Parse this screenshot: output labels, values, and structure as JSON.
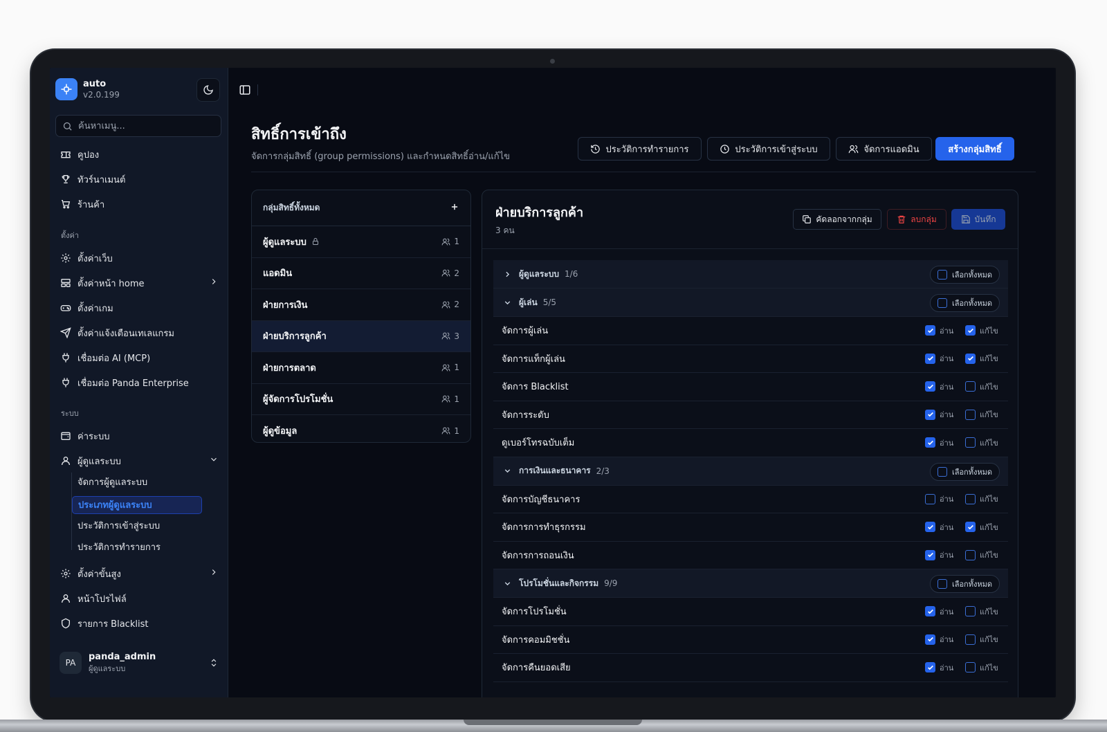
{
  "app": {
    "name": "auto",
    "version": "v2.0.199"
  },
  "search": {
    "placeholder": "ค้นหาเมนู..."
  },
  "nav": {
    "top": [
      {
        "label": "คูปอง",
        "icon": "ticket-icon"
      },
      {
        "label": "ทัวร์นาเมนต์",
        "icon": "trophy-icon"
      },
      {
        "label": "ร้านค้า",
        "icon": "cart-icon"
      }
    ],
    "settings_section": "ตั้งค่า",
    "settings": [
      {
        "label": "ตั้งค่าเว็บ",
        "icon": "gear-icon"
      },
      {
        "label": "ตั้งค่าหน้า home",
        "icon": "layout-icon"
      },
      {
        "label": "ตั้งค่าเกม",
        "icon": "gamepad-icon"
      },
      {
        "label": "ตั้งค่าแจ้งเตือนเทเลแกรม",
        "icon": "send-icon"
      },
      {
        "label": "เชื่อมต่อ AI (MCP)",
        "icon": "plug-icon"
      },
      {
        "label": "เชื่อมต่อ Panda Enterprise",
        "icon": "plug-icon"
      }
    ],
    "system_section": "ระบบ",
    "system": [
      {
        "label": "ค่าระบบ",
        "icon": "wallet-icon"
      },
      {
        "label": "ผู้ดูแลระบบ",
        "icon": "user-icon"
      }
    ],
    "admin_sub": [
      "จัดการผู้ดูแลระบบ",
      "ประเภทผู้ดูแลระบบ",
      "ประวัติการเข้าสู่ระบบ",
      "ประวัติการทำรายการ"
    ],
    "bottom": [
      {
        "label": "ตั้งค่าขั้นสูง",
        "icon": "gear-icon"
      },
      {
        "label": "หน้าโปรไฟล์",
        "icon": "user-icon"
      },
      {
        "label": "รายการ Blacklist",
        "icon": "shield-icon"
      }
    ]
  },
  "user": {
    "initials": "PA",
    "name": "panda_admin",
    "role": "ผู้ดูแลระบบ"
  },
  "page": {
    "title": "สิทธิ์การเข้าถึง",
    "subtitle": "จัดการกลุ่มสิทธิ์ (group permissions) และกำหนดสิทธิ์อ่าน/แก้ไข",
    "buttons": {
      "transaction_history": "ประวัติการทำรายการ",
      "login_history": "ประวัติการเข้าสู่ระบบ",
      "manage_admins": "จัดการแอดมิน",
      "create_group": "สร้างกลุ่มสิทธิ์"
    }
  },
  "groups": {
    "header": "กลุ่มสิทธิ์ทั้งหมด",
    "items": [
      {
        "name": "ผู้ดูแลระบบ",
        "count": "1",
        "locked": true
      },
      {
        "name": "แอดมิน",
        "count": "2"
      },
      {
        "name": "ฝ่ายการเงิน",
        "count": "2"
      },
      {
        "name": "ฝ่ายบริการลูกค้า",
        "count": "3",
        "active": true
      },
      {
        "name": "ฝ่ายการตลาด",
        "count": "1"
      },
      {
        "name": "ผู้จัดการโปรโมชั่น",
        "count": "1"
      },
      {
        "name": "ผู้ดูข้อมูล",
        "count": "1"
      }
    ]
  },
  "detail": {
    "title": "ฝ่ายบริการลูกค้า",
    "member_count": "3 คน",
    "copy_label": "คัดลอกจากกลุ่ม",
    "delete_label": "ลบกลุ่ม",
    "save_label": "บันทึก",
    "select_all_label": "เลือกทั้งหมด",
    "read_label": "อ่าน",
    "write_label": "แก้ไข",
    "categories": [
      {
        "label": "ผู้ดูแลระบบ",
        "fraction": "1/6",
        "expanded": false,
        "perms": []
      },
      {
        "label": "ผู้เล่น",
        "fraction": "5/5",
        "expanded": true,
        "perms": [
          {
            "label": "จัดการผู้เล่น",
            "read": true,
            "write": true
          },
          {
            "label": "จัดการแท็กผู้เล่น",
            "read": true,
            "write": true
          },
          {
            "label": "จัดการ Blacklist",
            "read": true,
            "write": false
          },
          {
            "label": "จัดการระดับ",
            "read": true,
            "write": false
          },
          {
            "label": "ดูเบอร์โทรฉบับเต็ม",
            "read": true,
            "write": false
          }
        ]
      },
      {
        "label": "การเงินและธนาคาร",
        "fraction": "2/3",
        "expanded": true,
        "perms": [
          {
            "label": "จัดการบัญชีธนาคาร",
            "read": false,
            "write": false
          },
          {
            "label": "จัดการการทำธุรกรรม",
            "read": true,
            "write": true
          },
          {
            "label": "จัดการการถอนเงิน",
            "read": true,
            "write": false
          }
        ]
      },
      {
        "label": "โปรโมชั่นและกิจกรรม",
        "fraction": "9/9",
        "expanded": true,
        "perms": [
          {
            "label": "จัดการโปรโมชั่น",
            "read": true,
            "write": false
          },
          {
            "label": "จัดการคอมมิชชั่น",
            "read": true,
            "write": false
          },
          {
            "label": "จัดการคืนยอดเสีย",
            "read": true,
            "write": false
          }
        ]
      }
    ]
  },
  "colors": {
    "accent": "#2563eb",
    "danger": "#ef4444",
    "background": "#080b14",
    "sidebar": "#111827"
  }
}
